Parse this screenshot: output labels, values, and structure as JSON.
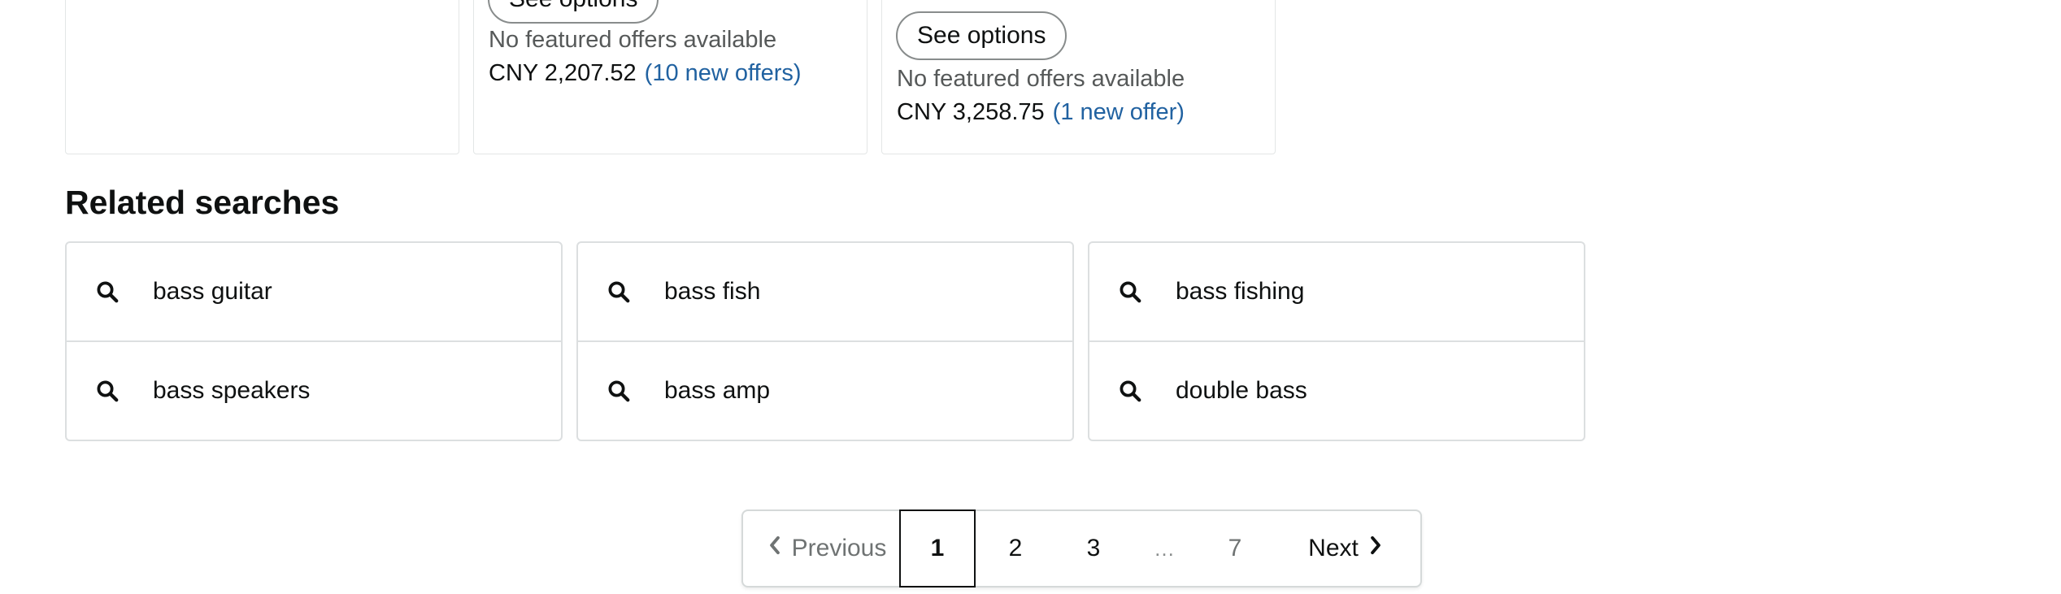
{
  "products": [
    {
      "see_options_label": "",
      "no_offers_text": "",
      "price": "",
      "offers_link": ""
    },
    {
      "see_options_label": "See options",
      "no_offers_text": "No featured offers available",
      "price": "CNY 2,207.52",
      "offers_link": "(10 new offers)"
    },
    {
      "see_options_label": "See options",
      "no_offers_text": "No featured offers available",
      "price": "CNY 3,258.75",
      "offers_link": "(1 new offer)"
    }
  ],
  "related_searches": {
    "title": "Related searches",
    "icon": "search-icon",
    "items": [
      {
        "label": "bass guitar"
      },
      {
        "label": "bass fish"
      },
      {
        "label": "bass fishing"
      },
      {
        "label": "bass speakers"
      },
      {
        "label": "bass amp"
      },
      {
        "label": "double bass"
      }
    ]
  },
  "pagination": {
    "previous_label": "Previous",
    "next_label": "Next",
    "current_page": "1",
    "pages": [
      "2",
      "3"
    ],
    "ellipsis": "…",
    "last_page": "7"
  },
  "colors": {
    "link": "#2162a1",
    "text": "#0f1111",
    "muted": "#565959",
    "border": "#d5d9d9"
  }
}
